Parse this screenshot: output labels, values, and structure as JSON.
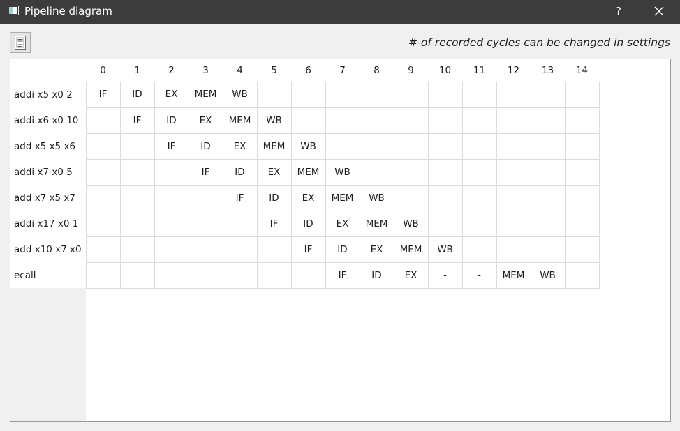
{
  "window": {
    "title": "Pipeline diagram",
    "help_label": "?",
    "close_icon": "close-icon",
    "app_icon": "window-app-icon"
  },
  "toolbar": {
    "export_icon": "document-lines-icon",
    "hint": "# of recorded cycles can be changed in settings"
  },
  "colors": {
    "titlebar": "#3c3c3c",
    "background": "#f0f0f0",
    "grid_line": "#dcdcdc"
  },
  "diagram": {
    "cycles": [
      "0",
      "1",
      "2",
      "3",
      "4",
      "5",
      "6",
      "7",
      "8",
      "9",
      "10",
      "11",
      "12",
      "13",
      "14"
    ],
    "rows": [
      {
        "instruction": "addi x5 x0 2",
        "stages": [
          "IF",
          "ID",
          "EX",
          "MEM",
          "WB",
          "",
          "",
          "",
          "",
          "",
          "",
          "",
          "",
          "",
          ""
        ]
      },
      {
        "instruction": "addi x6 x0 10",
        "stages": [
          "",
          "IF",
          "ID",
          "EX",
          "MEM",
          "WB",
          "",
          "",
          "",
          "",
          "",
          "",
          "",
          "",
          ""
        ]
      },
      {
        "instruction": "add x5 x5 x6",
        "stages": [
          "",
          "",
          "IF",
          "ID",
          "EX",
          "MEM",
          "WB",
          "",
          "",
          "",
          "",
          "",
          "",
          "",
          ""
        ]
      },
      {
        "instruction": "addi x7 x0 5",
        "stages": [
          "",
          "",
          "",
          "IF",
          "ID",
          "EX",
          "MEM",
          "WB",
          "",
          "",
          "",
          "",
          "",
          "",
          ""
        ]
      },
      {
        "instruction": "add x7 x5 x7",
        "stages": [
          "",
          "",
          "",
          "",
          "IF",
          "ID",
          "EX",
          "MEM",
          "WB",
          "",
          "",
          "",
          "",
          "",
          ""
        ]
      },
      {
        "instruction": "addi x17 x0 1",
        "stages": [
          "",
          "",
          "",
          "",
          "",
          "IF",
          "ID",
          "EX",
          "MEM",
          "WB",
          "",
          "",
          "",
          "",
          ""
        ]
      },
      {
        "instruction": "add x10 x7 x0",
        "stages": [
          "",
          "",
          "",
          "",
          "",
          "",
          "IF",
          "ID",
          "EX",
          "MEM",
          "WB",
          "",
          "",
          "",
          ""
        ]
      },
      {
        "instruction": "ecall",
        "stages": [
          "",
          "",
          "",
          "",
          "",
          "",
          "",
          "IF",
          "ID",
          "EX",
          "-",
          "-",
          "MEM",
          "WB",
          ""
        ]
      }
    ]
  }
}
